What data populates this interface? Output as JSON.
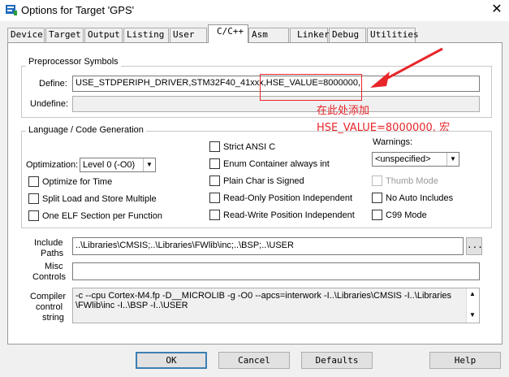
{
  "window": {
    "title": "Options for Target 'GPS'",
    "close_glyph": "✕"
  },
  "tabs": [
    {
      "label": "Device",
      "key": "D"
    },
    {
      "label": "Target",
      "key": "T"
    },
    {
      "label": "Output",
      "key": "O"
    },
    {
      "label": "Listing",
      "key": "L"
    },
    {
      "label": "User",
      "key": "U"
    },
    {
      "label": "C/C++",
      "key": "C",
      "active": true
    },
    {
      "label": "Asm",
      "key": "A"
    },
    {
      "label": "Linker",
      "key": "L"
    },
    {
      "label": "Debug",
      "key": "D"
    },
    {
      "label": "Utilities",
      "key": "U"
    }
  ],
  "preprocessor": {
    "group_label": "Preprocessor Symbols",
    "define_label": "Define:",
    "define_value": "USE_STDPERIPH_DRIVER,STM32F40_41xxx,HSE_VALUE=8000000,",
    "undefine_label": "Undefine:",
    "undefine_value": ""
  },
  "annotation": {
    "line1": "在此处添加",
    "line2": "HSE_VALUE=8000000, 宏",
    "color": "#e8262a"
  },
  "language": {
    "group_label": "Language / Code Generation",
    "optimization_label": "Optimization:",
    "optimization_value": "Level 0 (-O0)",
    "warnings_label": "Warnings:",
    "warnings_value": "<unspecified>",
    "options": [
      {
        "id": "optimize-time",
        "label": "Optimize for Time",
        "checked": false,
        "enabled": true
      },
      {
        "id": "split-load-store",
        "label": "Split Load and Store Multiple",
        "checked": false,
        "enabled": true
      },
      {
        "id": "one-elf-section",
        "label": "One ELF Section per Function",
        "checked": false,
        "enabled": true
      },
      {
        "id": "strict-ansi",
        "label": "Strict ANSI C",
        "checked": false,
        "enabled": true
      },
      {
        "id": "enum-container",
        "label": "Enum Container always int",
        "checked": false,
        "enabled": true
      },
      {
        "id": "plain-char-signed",
        "label": "Plain Char is Signed",
        "checked": false,
        "enabled": true
      },
      {
        "id": "ro-position-independent",
        "label": "Read-Only Position Independent",
        "checked": false,
        "enabled": true
      },
      {
        "id": "rw-position-independent",
        "label": "Read-Write Position Independent",
        "checked": false,
        "enabled": true
      },
      {
        "id": "thumb-mode",
        "label": "Thumb Mode",
        "checked": false,
        "enabled": false
      },
      {
        "id": "no-auto-includes",
        "label": "No Auto Includes",
        "checked": false,
        "enabled": true
      },
      {
        "id": "c99-mode",
        "label": "C99 Mode",
        "checked": false,
        "enabled": true
      }
    ]
  },
  "include_paths": {
    "label_line1": "Include",
    "label_line2": "Paths",
    "value": "..\\Libraries\\CMSIS;..\\Libraries\\FWlib\\inc;..\\BSP;..\\USER",
    "browse_label": "..."
  },
  "misc_controls": {
    "label_line1": "Misc",
    "label_line2": "Controls",
    "value": ""
  },
  "compiler_control": {
    "label_line1": "Compiler",
    "label_line2": "control",
    "label_line3": "string",
    "line1": "-c --cpu Cortex-M4.fp -D__MICROLIB -g -O0 --apcs=interwork -I..\\Libraries\\CMSIS -I..\\Libraries",
    "line2": "\\FWlib\\inc -I..\\BSP -I..\\USER"
  },
  "buttons": {
    "ok": "OK",
    "cancel": "Cancel",
    "defaults": "Defaults",
    "help": "Help"
  }
}
